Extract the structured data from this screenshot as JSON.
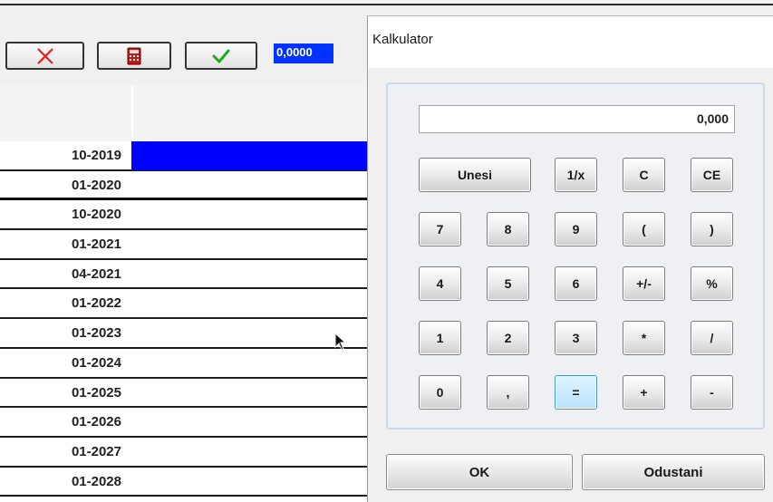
{
  "toolbar": {
    "value_display": "0,0000"
  },
  "grid": {
    "rows": [
      {
        "date": "10-2019",
        "selected": true
      },
      {
        "date": "01-2020",
        "thick": true
      },
      {
        "date": "10-2020"
      },
      {
        "date": "01-2021"
      },
      {
        "date": "04-2021"
      },
      {
        "date": "01-2022"
      },
      {
        "date": "01-2023"
      },
      {
        "date": "01-2024"
      },
      {
        "date": "01-2025"
      },
      {
        "date": "01-2026"
      },
      {
        "date": "01-2027"
      },
      {
        "date": "01-2028"
      }
    ]
  },
  "dialog": {
    "title": "Kalkulator",
    "display": "0,000",
    "keys": {
      "enter": "Unesi",
      "reciprocal": "1/x",
      "clear": "C",
      "clear_entry": "CE",
      "k7": "7",
      "k8": "8",
      "k9": "9",
      "lparen": "(",
      "rparen": ")",
      "k4": "4",
      "k5": "5",
      "k6": "6",
      "plusminus": "+/-",
      "percent": "%",
      "k1": "1",
      "k2": "2",
      "k3": "3",
      "multiply": "*",
      "divide": "/",
      "k0": "0",
      "comma": ",",
      "equals": "=",
      "plus": "+",
      "minus": "-"
    },
    "ok_label": "OK",
    "cancel_label": "Odustani"
  },
  "colors": {
    "selection": "#0000ff",
    "value_box": "#0033ff",
    "cancel_icon": "#e02020",
    "confirm_icon": "#22aa22",
    "calc_icon": "#c21818",
    "equals_key": "#b8e3fb"
  }
}
